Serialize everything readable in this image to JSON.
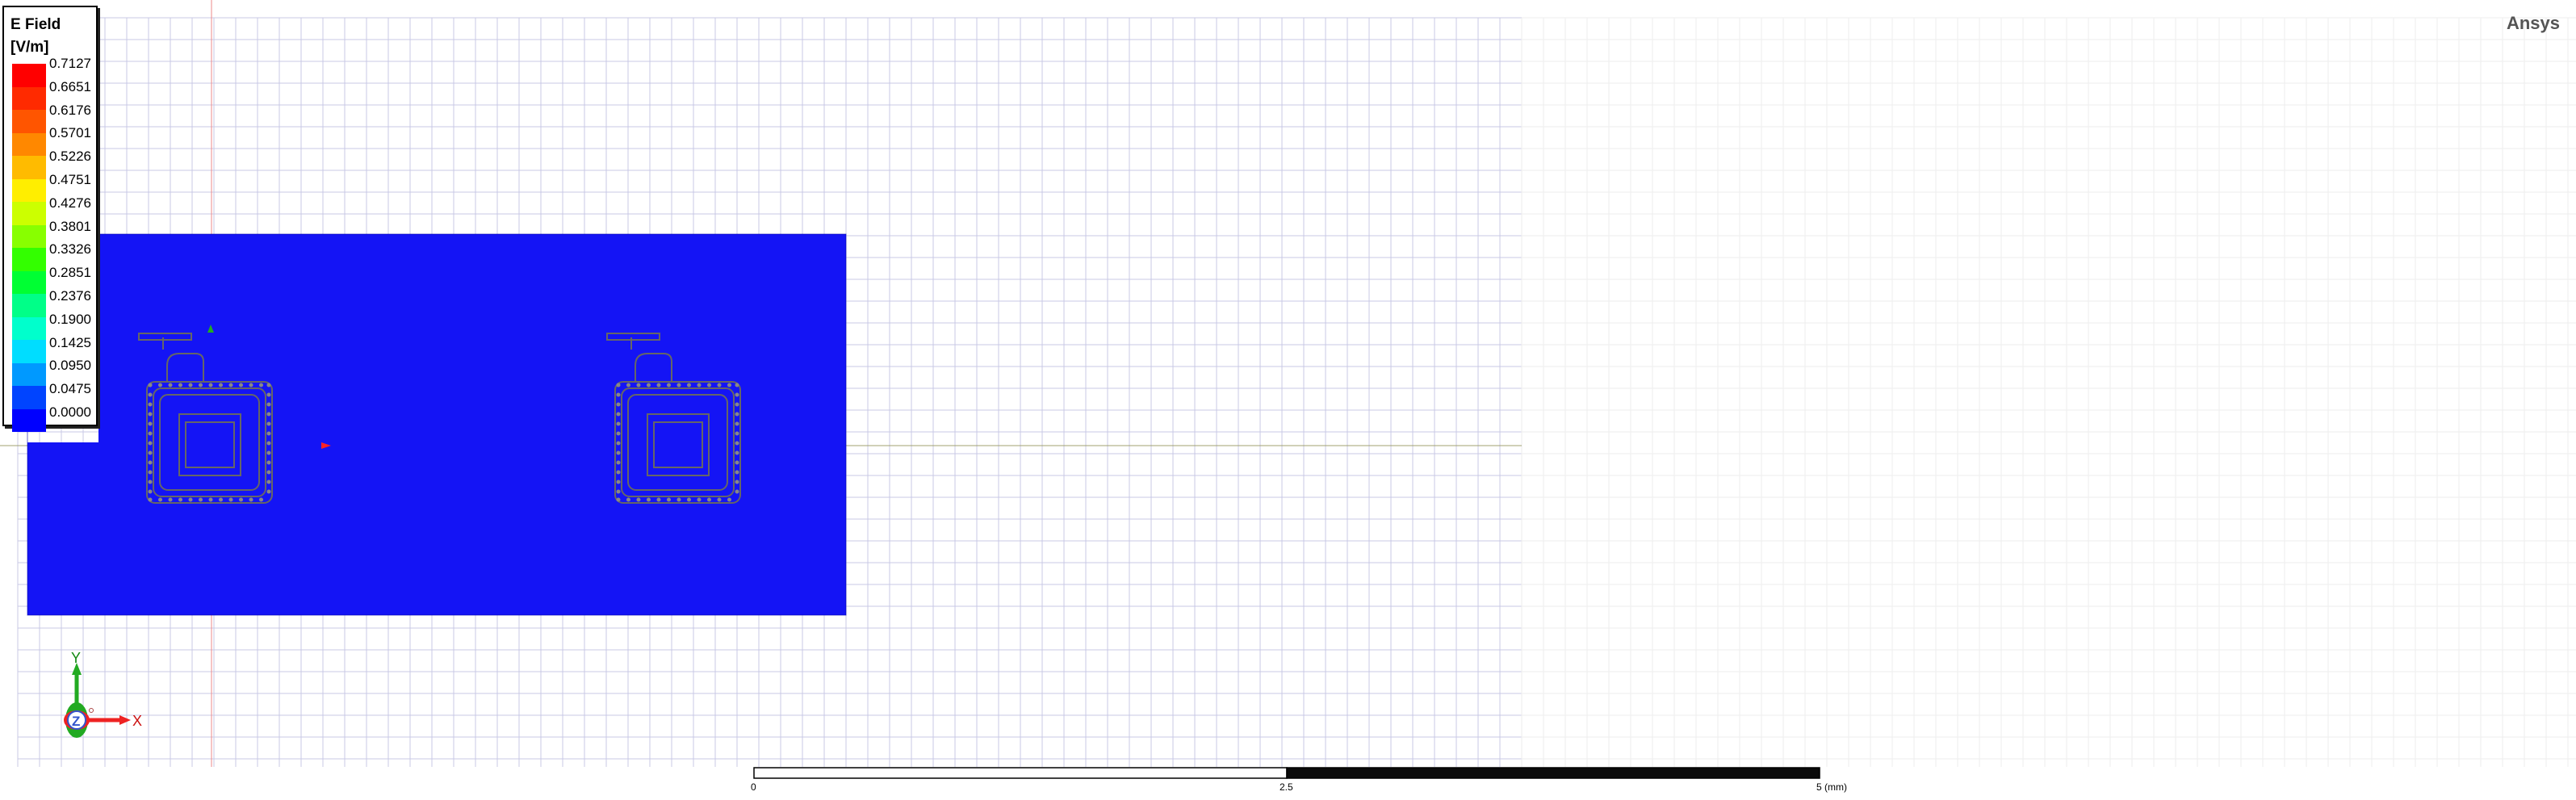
{
  "brand": "Ansys",
  "legend": {
    "title": "E Field",
    "units": "[V/m]",
    "levels": [
      {
        "value": "0.7127",
        "color": "#ff0000"
      },
      {
        "value": "0.6651",
        "color": "#ff2a00"
      },
      {
        "value": "0.6176",
        "color": "#ff5500"
      },
      {
        "value": "0.5701",
        "color": "#ff8800"
      },
      {
        "value": "0.5226",
        "color": "#ffbb00"
      },
      {
        "value": "0.4751",
        "color": "#ffee00"
      },
      {
        "value": "0.4276",
        "color": "#ccff00"
      },
      {
        "value": "0.3801",
        "color": "#88ff00"
      },
      {
        "value": "0.3326",
        "color": "#33ff00"
      },
      {
        "value": "0.2851",
        "color": "#00ff33"
      },
      {
        "value": "0.2376",
        "color": "#00ff88"
      },
      {
        "value": "0.1900",
        "color": "#00ffcc"
      },
      {
        "value": "0.1425",
        "color": "#00ddff"
      },
      {
        "value": "0.0950",
        "color": "#0099ff"
      },
      {
        "value": "0.0475",
        "color": "#0044ff"
      },
      {
        "value": "0.0000",
        "color": "#0000ff"
      }
    ]
  },
  "field_color": "#1414f5",
  "scale_bar": {
    "labels": [
      "0",
      "2.5",
      "5 (mm)"
    ]
  },
  "triad": {
    "x_label": "X",
    "y_label": "Y",
    "z_label": "Z"
  }
}
